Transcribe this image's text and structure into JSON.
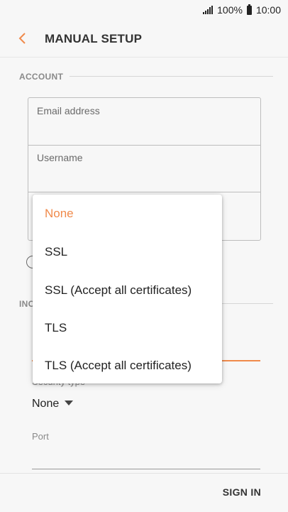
{
  "status_bar": {
    "battery": "100%",
    "time": "10:00"
  },
  "header": {
    "title": "MANUAL SETUP"
  },
  "account_section": {
    "label": "ACCOUNT",
    "fields": [
      {
        "label": "Email address"
      },
      {
        "label": "Username"
      }
    ]
  },
  "incoming_section": {
    "label_partial": "INC"
  },
  "security": {
    "label_partial": "Security type",
    "value": "None"
  },
  "port": {
    "label": "Port"
  },
  "footer": {
    "sign_in": "SIGN IN"
  },
  "dropdown": {
    "options": [
      {
        "label": "None",
        "selected": true
      },
      {
        "label": "SSL",
        "selected": false
      },
      {
        "label": "SSL (Accept all certificates)",
        "selected": false
      },
      {
        "label": "TLS",
        "selected": false
      },
      {
        "label": "TLS (Accept all certificates)",
        "selected": false
      }
    ]
  },
  "colors": {
    "accent": "#f08a4b",
    "background": "#f7f7f7"
  }
}
